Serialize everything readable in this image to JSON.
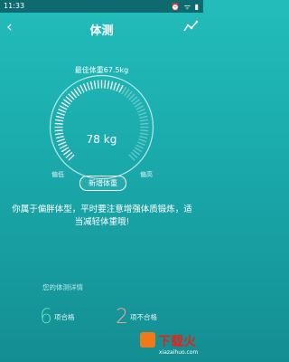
{
  "status_bar": {
    "time": "11:33",
    "icons": "⏰ ᯤ ▮"
  },
  "nav": {
    "title": "体测",
    "back_glyph": "‹"
  },
  "gauge": {
    "best_weight": "最佳体重67.5kg",
    "reading": "78 kg",
    "low_label": "偏低",
    "high_label": "偏高",
    "add_button": "新增体重",
    "level_fraction": 0.6
  },
  "advice": "你属于偏胖体型，平时要注意增强体质锻炼，适当减轻体重哦!",
  "summary": {
    "title": "您的体测详情",
    "pass_count": "6",
    "pass_label": "项合格",
    "fail_count": "2",
    "fail_label": "项不合格"
  },
  "watermark": {
    "text": "下载火",
    "url": "xiazaihuo.com"
  },
  "colors": {
    "pass": "#5fe0c2",
    "fail": "#f4a4a4",
    "accent": "#22bdbb"
  }
}
